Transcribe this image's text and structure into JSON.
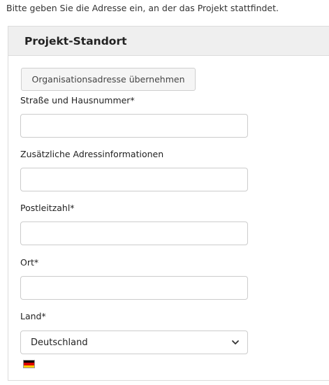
{
  "intro_text": "Bitte geben Sie die Adresse ein, an der das Projekt stattfindet.",
  "panel": {
    "title": "Projekt-Standort",
    "org_button_label": "Organisationsadresse übernehmen",
    "fields": {
      "street_label": "Straße und Hausnummer*",
      "street_value": "",
      "additional_label": "Zusätzliche Adressinformationen",
      "additional_value": "",
      "zip_label": "Postleitzahl*",
      "zip_value": "",
      "city_label": "Ort*",
      "city_value": "",
      "country_label": "Land*",
      "country_value": "Deutschland"
    },
    "flag": {
      "icon": "germany-flag-icon",
      "colors": [
        "#000000",
        "#dd0000",
        "#ffce00"
      ]
    }
  },
  "colors": {
    "header_bg": "#efefef",
    "border": "#dcdcdc"
  }
}
